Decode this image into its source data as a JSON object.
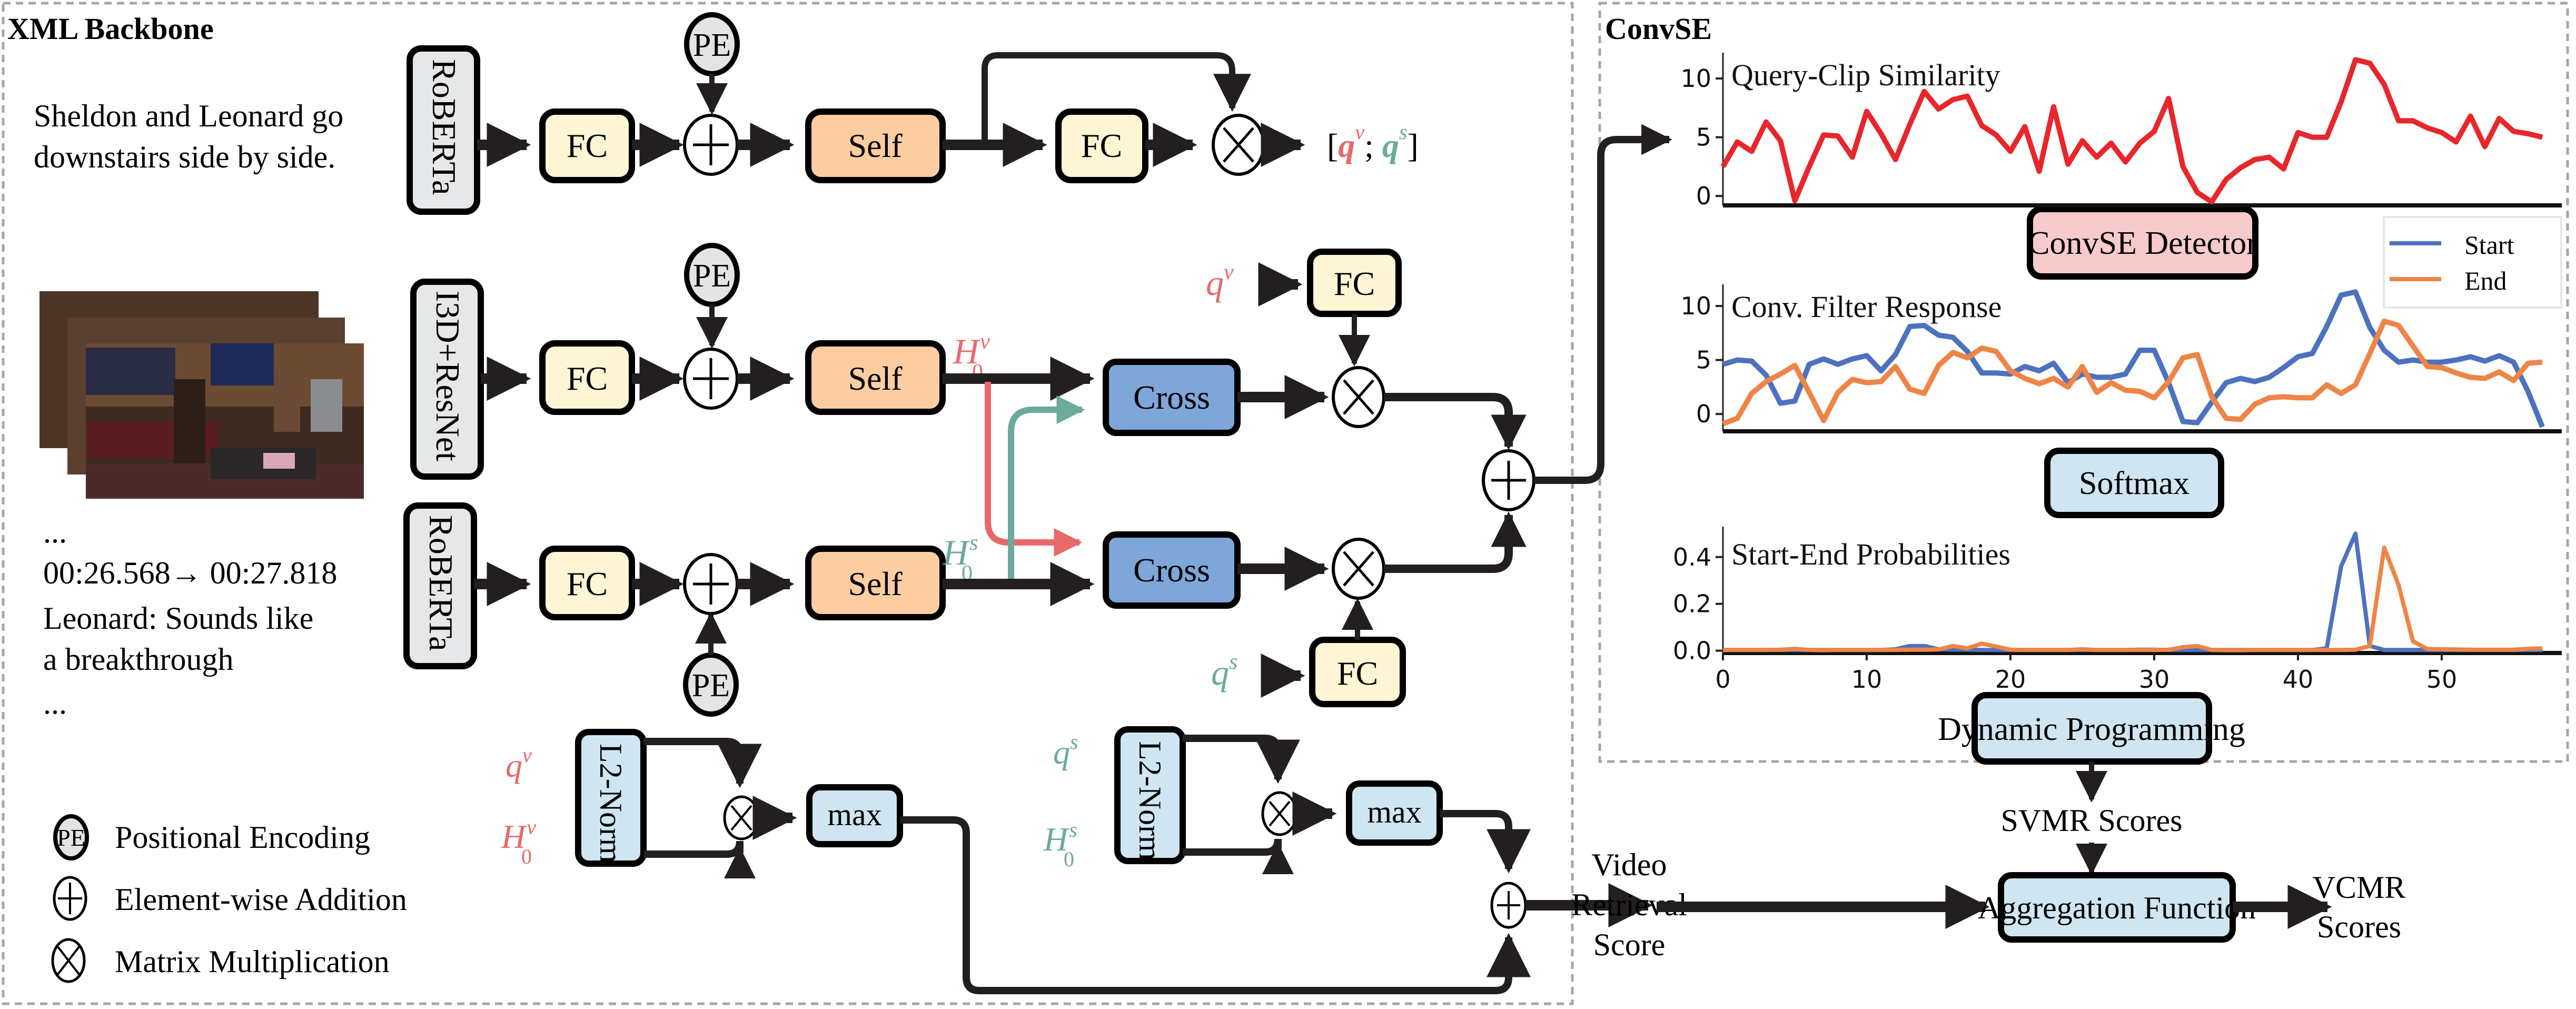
{
  "colors": {
    "video_red": "#e8696b",
    "subtitle_teal": "#6aab9c",
    "encoder_gray_fill": "#e6e7e8",
    "fc_fill": "#fdf5d3",
    "self_fill": "#fbcda0",
    "cross_fill": "#7ea6d8",
    "detector_fill": "#f7cacc",
    "lightblue_fill": "#cfe6f2",
    "pe_fill": "#e3e5e4",
    "sim_line": "#e8262b",
    "start_line": "#4c72bf",
    "end_line": "#ee8547",
    "dash_gray": "#a6a6a6",
    "arrow_black": "#231f20"
  },
  "backbone": {
    "title": "XML Backbone",
    "query_text": [
      "Sheldon and Leonard go",
      "downstairs side by side."
    ],
    "subtitle_text": [
      "...",
      "00:26.568→ 00:27.818",
      "Leonard: Sounds like",
      "a breakthrough",
      "..."
    ],
    "encoders": {
      "query_encoder": "RoBERTa",
      "video_encoder": "I3D+ResNet",
      "subtitle_encoder": "RoBERTa"
    },
    "blocks": {
      "fc": "FC",
      "self": "Self",
      "cross": "Cross",
      "pe": "PE",
      "l2norm": "L2-Norm",
      "max": "max"
    },
    "symbols": {
      "q": "q",
      "H": "H",
      "sub0": "0",
      "sup_v": "v",
      "sup_s": "s",
      "concat_open": "[",
      "concat_sep": ";",
      "concat_close": "]"
    },
    "legend": [
      {
        "icon": "pe-circle-icon",
        "glyph": "PE",
        "label": "Positional Encoding"
      },
      {
        "icon": "plus-circle-icon",
        "glyph": "+",
        "label": "Element-wise Addition"
      },
      {
        "icon": "times-circle-icon",
        "glyph": "×",
        "label": "Matrix Multiplication"
      }
    ]
  },
  "convse": {
    "title": "ConvSE",
    "detector_label": "ConvSE Detector",
    "softmax_label": "Softmax",
    "dp_label": "Dynamic Programming"
  },
  "outputs": {
    "svmr_scores": "SVMR Scores",
    "video_retrieval_score": [
      "Video",
      "Retrieval",
      "Score"
    ],
    "aggregation_label": "Aggregation Function",
    "vcmr_scores": [
      "VCMR",
      "Scores"
    ]
  },
  "chart_data": [
    {
      "type": "line",
      "title": "Query-Clip Similarity",
      "xlabel": "",
      "ylabel": "",
      "xlim": [
        0,
        57.5
      ],
      "ylim": [
        -0.8,
        12.2
      ],
      "yticks": [
        0,
        5,
        10
      ],
      "xticks_visible": false,
      "grid": false,
      "series": [
        {
          "name": "Query-Clip Similarity",
          "color_key": "sim_line",
          "values": [
            2.5,
            4.6,
            3.8,
            6.3,
            4.7,
            -0.4,
            2.5,
            5.2,
            5.1,
            3.3,
            7.2,
            5.3,
            3.1,
            6.1,
            8.9,
            7.4,
            8.2,
            8.5,
            6.0,
            5.2,
            3.8,
            5.9,
            2.1,
            7.6,
            2.7,
            4.7,
            3.3,
            4.5,
            2.9,
            4.5,
            5.5,
            8.3,
            2.5,
            0.3,
            -0.5,
            1.4,
            2.4,
            3.1,
            3.3,
            2.3,
            5.4,
            5.0,
            5.0,
            8.0,
            11.6,
            11.3,
            9.5,
            6.4,
            6.4,
            5.8,
            5.4,
            4.6,
            6.8,
            4.2,
            6.6,
            5.5,
            5.3,
            5.0
          ]
        }
      ]
    },
    {
      "type": "line",
      "title": "Conv. Filter Response",
      "xlabel": "",
      "ylabel": "",
      "xlim": [
        0,
        57.5
      ],
      "ylim": [
        -1.6,
        12.0
      ],
      "yticks": [
        0,
        5,
        10
      ],
      "xticks_visible": false,
      "grid": false,
      "legend": {
        "placement": "top-right",
        "entries": [
          "Start",
          "End"
        ]
      },
      "series": [
        {
          "name": "Start",
          "color_key": "start_line",
          "values": [
            4.6,
            5.0,
            4.9,
            3.6,
            1.0,
            1.2,
            4.6,
            5.1,
            4.6,
            5.1,
            5.4,
            4.0,
            5.5,
            8.1,
            8.2,
            7.3,
            7.1,
            5.8,
            3.8,
            3.8,
            3.7,
            4.4,
            4.0,
            4.7,
            2.9,
            3.7,
            3.4,
            3.4,
            3.7,
            5.9,
            5.9,
            2.9,
            -0.7,
            -0.8,
            1.1,
            2.9,
            3.3,
            3.0,
            3.4,
            4.3,
            5.3,
            5.6,
            8.1,
            11.0,
            11.3,
            8.0,
            5.9,
            4.8,
            5.0,
            4.8,
            4.8,
            5.0,
            5.3,
            4.9,
            5.4,
            4.8,
            2.1,
            -1.2
          ]
        },
        {
          "name": "End",
          "color_key": "end_line",
          "values": [
            -0.9,
            -0.4,
            1.9,
            3.0,
            3.7,
            4.5,
            2.0,
            -0.6,
            2.0,
            3.2,
            2.9,
            3.0,
            4.4,
            2.3,
            1.9,
            4.5,
            5.7,
            5.2,
            6.1,
            5.8,
            4.0,
            3.3,
            2.8,
            3.3,
            2.5,
            4.4,
            2.0,
            2.9,
            2.2,
            2.1,
            1.5,
            3.0,
            5.2,
            5.5,
            1.6,
            -0.4,
            -0.5,
            0.9,
            1.5,
            1.6,
            1.5,
            1.5,
            2.7,
            1.9,
            2.7,
            5.6,
            8.6,
            8.2,
            6.3,
            4.4,
            4.3,
            3.8,
            3.4,
            3.3,
            3.9,
            3.1,
            4.7,
            4.8
          ]
        }
      ]
    },
    {
      "type": "line",
      "title": "Start-End Probabilities",
      "xlabel": "",
      "ylabel": "",
      "xlim": [
        0,
        57.5
      ],
      "ylim": [
        -0.01,
        0.53
      ],
      "yticks": [
        0.0,
        0.2,
        0.4
      ],
      "ytick_labels": [
        "0.0",
        "0.2",
        "0.4"
      ],
      "xticks": [
        0,
        10,
        20,
        30,
        40,
        50
      ],
      "xtick_labels": [
        "0",
        "10",
        "20",
        "30",
        "40",
        "50"
      ],
      "grid": false,
      "series": [
        {
          "name": "Start",
          "color_key": "start_line",
          "values": [
            0.003,
            0.003,
            0.003,
            0.003,
            0.003,
            0.003,
            0.003,
            0.003,
            0.003,
            0.003,
            0.003,
            0.003,
            0.006,
            0.02,
            0.02,
            0.006,
            0.004,
            0.004,
            0.003,
            0.003,
            0.003,
            0.003,
            0.003,
            0.003,
            0.003,
            0.003,
            0.003,
            0.003,
            0.003,
            0.004,
            0.004,
            0.003,
            0.003,
            0.003,
            0.003,
            0.003,
            0.003,
            0.003,
            0.003,
            0.003,
            0.003,
            0.003,
            0.01,
            0.36,
            0.5,
            0.02,
            0.003,
            0.003,
            0.003,
            0.003,
            0.003,
            0.003,
            0.003,
            0.003,
            0.003,
            0.003,
            0.003,
            0.003
          ]
        },
        {
          "name": "End",
          "color_key": "end_line",
          "values": [
            0.003,
            0.003,
            0.003,
            0.003,
            0.004,
            0.008,
            0.003,
            0.002,
            0.003,
            0.003,
            0.003,
            0.003,
            0.003,
            0.004,
            0.004,
            0.005,
            0.02,
            0.01,
            0.03,
            0.018,
            0.004,
            0.003,
            0.003,
            0.003,
            0.003,
            0.006,
            0.003,
            0.003,
            0.003,
            0.003,
            0.003,
            0.004,
            0.015,
            0.02,
            0.003,
            0.002,
            0.002,
            0.003,
            0.003,
            0.003,
            0.003,
            0.003,
            0.003,
            0.003,
            0.004,
            0.02,
            0.44,
            0.28,
            0.04,
            0.007,
            0.006,
            0.005,
            0.004,
            0.004,
            0.004,
            0.004,
            0.008,
            0.01
          ]
        }
      ]
    }
  ]
}
